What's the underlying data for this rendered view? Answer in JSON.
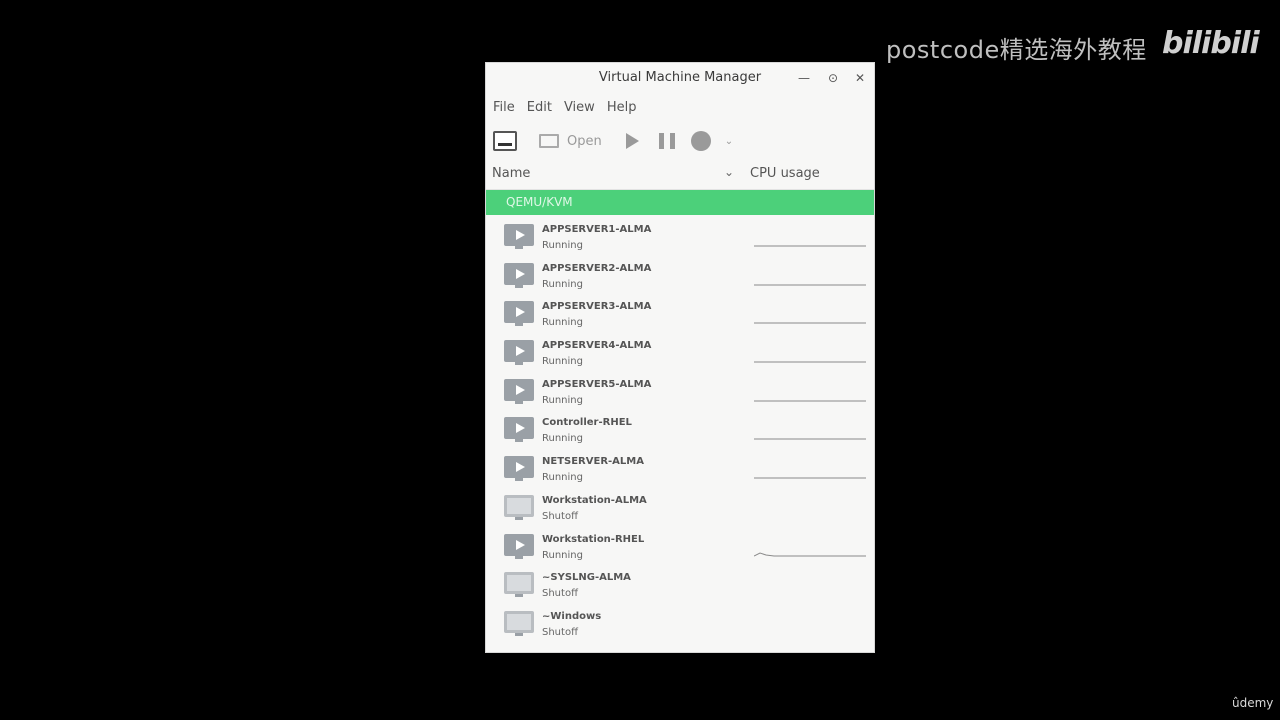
{
  "overlay": {
    "watermark": "postcode精选海外教程",
    "brand_logo": "bilibili",
    "udemy": "ûdemy"
  },
  "window": {
    "title": "Virtual Machine Manager",
    "controls": {
      "minimize": "—",
      "maximize": "⊙",
      "close": "✕"
    }
  },
  "menubar": [
    "File",
    "Edit",
    "View",
    "Help"
  ],
  "toolbar": {
    "open_label": "Open",
    "icons": [
      "new-vm-icon",
      "monitor-icon",
      "play-icon",
      "pause-icon",
      "stop-icon",
      "chevron-down-icon"
    ]
  },
  "columns": {
    "name": "Name",
    "cpu": "CPU usage"
  },
  "connection": {
    "label": "QEMU/KVM",
    "color": "#4cd07a"
  },
  "vms": [
    {
      "name": "APPSERVER1-ALMA",
      "status": "Running",
      "state": "running"
    },
    {
      "name": "APPSERVER2-ALMA",
      "status": "Running",
      "state": "running"
    },
    {
      "name": "APPSERVER3-ALMA",
      "status": "Running",
      "state": "running"
    },
    {
      "name": "APPSERVER4-ALMA",
      "status": "Running",
      "state": "running"
    },
    {
      "name": "APPSERVER5-ALMA",
      "status": "Running",
      "state": "running"
    },
    {
      "name": "Controller-RHEL",
      "status": "Running",
      "state": "running"
    },
    {
      "name": "NETSERVER-ALMA",
      "status": "Running",
      "state": "running"
    },
    {
      "name": "Workstation-ALMA",
      "status": "Shutoff",
      "state": "shutoff"
    },
    {
      "name": "Workstation-RHEL",
      "status": "Running",
      "state": "running"
    },
    {
      "name": "~SYSLNG-ALMA",
      "status": "Shutoff",
      "state": "shutoff"
    },
    {
      "name": "~Windows",
      "status": "Shutoff",
      "state": "shutoff"
    }
  ]
}
